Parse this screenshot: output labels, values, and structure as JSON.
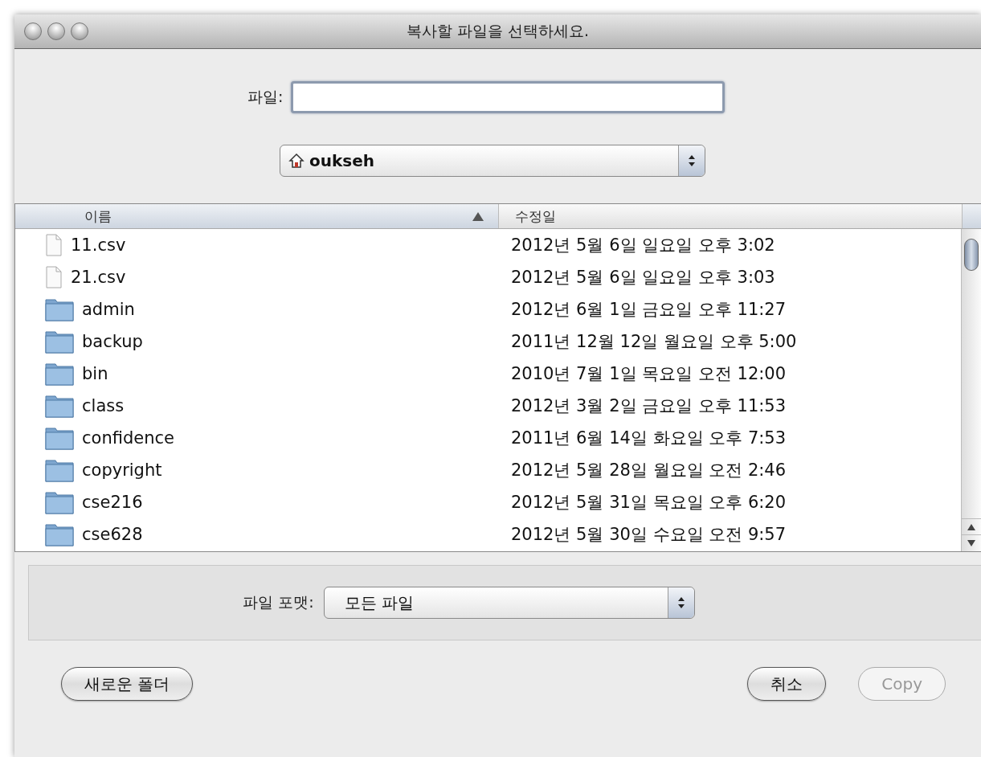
{
  "window": {
    "title": "복사할 파일을 선택하세요."
  },
  "file_field": {
    "label": "파일:"
  },
  "location": {
    "label": "oukseh"
  },
  "table": {
    "columns": [
      {
        "label": "이름",
        "sorted": true
      },
      {
        "label": "수정일",
        "sorted": false
      }
    ],
    "rows": [
      {
        "kind": "file",
        "name": "11.csv",
        "modified": "2012년 5월 6일 일요일 오후 3:02"
      },
      {
        "kind": "file",
        "name": "21.csv",
        "modified": "2012년 5월 6일 일요일 오후 3:03"
      },
      {
        "kind": "folder",
        "name": "admin",
        "modified": "2012년 6월 1일 금요일 오후 11:27"
      },
      {
        "kind": "folder",
        "name": "backup",
        "modified": "2011년 12월 12일 월요일 오후 5:00"
      },
      {
        "kind": "folder",
        "name": "bin",
        "modified": "2010년 7월 1일 목요일 오전 12:00"
      },
      {
        "kind": "folder",
        "name": "class",
        "modified": "2012년 3월 2일 금요일 오후 11:53"
      },
      {
        "kind": "folder",
        "name": "confidence",
        "modified": "2011년 6월 14일 화요일 오후 7:53"
      },
      {
        "kind": "folder",
        "name": "copyright",
        "modified": "2012년 5월 28일 월요일 오전 2:46"
      },
      {
        "kind": "folder",
        "name": "cse216",
        "modified": "2012년 5월 31일 목요일 오후 6:20"
      },
      {
        "kind": "folder",
        "name": "cse628",
        "modified": "2012년 5월 30일 수요일 오전 9:57"
      }
    ]
  },
  "format": {
    "label": "파일 포맷:",
    "value": "모든 파일"
  },
  "buttons": [
    {
      "label": "새로운 폴더",
      "disabled": false
    },
    {
      "label": "취소",
      "disabled": false
    },
    {
      "label": "Copy",
      "disabled": true
    }
  ]
}
